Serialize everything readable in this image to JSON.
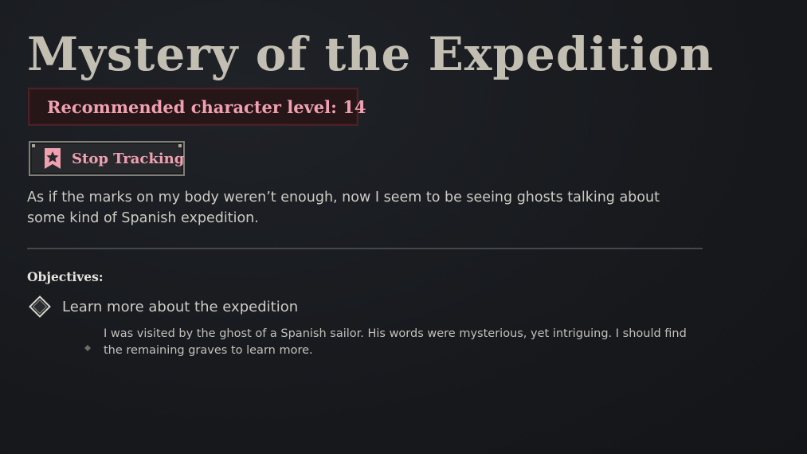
{
  "quest": {
    "title": "Mystery of the Expedition",
    "recommended_level": "Recommended character level: 14",
    "track_button_label": "Stop Tracking",
    "track_icon": "bookmark-star-icon",
    "description": "As if the marks on my body weren’t enough, now I seem to be seeing ghosts talking about some kind of Spanish expedition."
  },
  "objectives": {
    "heading": "Objectives:",
    "items": [
      {
        "icon": "diamond-objective-icon",
        "label": "Learn more about the expedition",
        "details": [
          "I was visited by the ghost of a Spanish sailor. His words were mysterious, yet intriguing. I should find the remaining graves to learn more."
        ]
      }
    ]
  },
  "colors": {
    "background": "#181b1f",
    "title": "#c3beb2",
    "accent_pink": "#f0a0b0",
    "level_box_bg": "#261618",
    "body_text": "#cdcbc4"
  }
}
